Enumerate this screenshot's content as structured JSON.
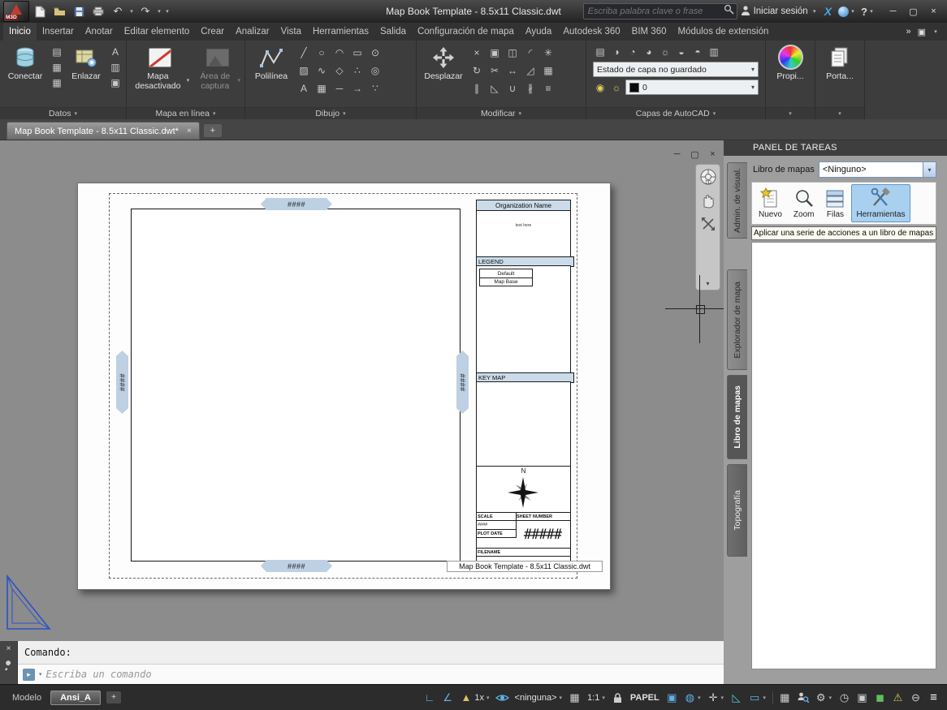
{
  "glyphs": {
    "chevron_down": "▾",
    "chevron_double": "»",
    "close": "×",
    "minimize": "─",
    "restore": "▢",
    "plus": "+",
    "undo": "↶",
    "redo": "↷",
    "question": "?",
    "x_brand": "X",
    "monitor": "▣",
    "line": "╱",
    "circle": "○",
    "arc": "◠",
    "rect": "▭",
    "ellipse": "⊙",
    "hatch": "▨",
    "spline": "∿",
    "polygon": "◇",
    "point": "∴",
    "donut": "◎",
    "text": "A",
    "table": "▦",
    "xline": "─",
    "ray": "→",
    "measure": "∵",
    "erase": "×",
    "copy": "▣",
    "mirror": "◫",
    "fillet": "◜",
    "explode": "✳",
    "rotate": "↻",
    "trim": "✂",
    "stretch": "↔",
    "scale": "◿",
    "array": "▦",
    "offset": "∥",
    "chamfer": "◺",
    "join": "∪",
    "break": "∦",
    "align": "≡",
    "layer_props": "▤",
    "layer_off": "◑",
    "layer_isolate": "◔",
    "layer_unisolate": "◕",
    "layer_freeze": "☼",
    "layer_lock": "◒",
    "layer_match": "◓",
    "layer_walk": "▥",
    "bulb": "◉",
    "sun": "☼",
    "ortho": "∟",
    "angle": "∠",
    "triangle": "▲",
    "grid": "▦",
    "globe": "◍",
    "crosshair": "✛",
    "tri_cyan": "◺",
    "rect_sel": "▭",
    "gear": "⚙",
    "clock": "◷",
    "cube": "◼",
    "warn": "⚠",
    "minus_circle": "⊖",
    "menu": "≡"
  },
  "titlebar": {
    "app_badge": "M3D",
    "title": "Map Book Template - 8.5x11 Classic.dwt",
    "search_placeholder": "Escriba palabra clave o frase",
    "signin": "Iniciar sesión"
  },
  "ribbon_tabs": [
    {
      "label": "Inicio"
    },
    {
      "label": "Insertar"
    },
    {
      "label": "Anotar"
    },
    {
      "label": "Editar elemento"
    },
    {
      "label": "Crear"
    },
    {
      "label": "Analizar"
    },
    {
      "label": "Vista"
    },
    {
      "label": "Herramientas"
    },
    {
      "label": "Salida"
    },
    {
      "label": "Configuración de mapa"
    },
    {
      "label": "Ayuda"
    },
    {
      "label": "Autodesk 360"
    },
    {
      "label": "BIM 360"
    },
    {
      "label": "Módulos de extensión"
    }
  ],
  "ribbon": {
    "datos": {
      "footer": "Datos",
      "connect": "Conectar",
      "link": "Enlazar"
    },
    "mapa": {
      "footer": "Mapa en línea",
      "map_off": "Mapa desactivado",
      "capture": "Área de captura"
    },
    "dibujo": {
      "footer": "Dibujo",
      "polyline": "Polilínea"
    },
    "modificar": {
      "footer": "Modificar",
      "move": "Desplazar"
    },
    "capas": {
      "footer": "Capas de AutoCAD",
      "layer_state": "Estado de capa no guardado",
      "layer_name": "0"
    },
    "propiedades": {
      "label": "Propi..."
    },
    "portaplanos": {
      "label": "Porta..."
    }
  },
  "doc_tab": {
    "label": "Map Book Template - 8.5x11 Classic.dwt*"
  },
  "template": {
    "org_name": "Organization Name",
    "org_text": "text here",
    "legend_title": "LEGEND",
    "legend_item_1": "Default",
    "legend_item_2": "Map Base",
    "keymap_title": "KEY MAP",
    "north_label": "N",
    "grip_label": "####",
    "scale_label": "SCALE",
    "scale_value": "####",
    "sheet_number_label": "SHEET NUMBER",
    "sheet_number_value": "#####",
    "plot_date_label": "PLOT DATE",
    "filename_label": "FILENAME",
    "caption": "Map Book Template - 8.5x11 Classic.dwt"
  },
  "task_panel": {
    "title": "PANEL DE TAREAS",
    "map_book_label": "Libro de mapas",
    "map_book_value": "<Ninguno>",
    "toolbar": [
      {
        "label": "Nuevo"
      },
      {
        "label": "Zoom"
      },
      {
        "label": "Filas"
      },
      {
        "label": "Herramientas"
      }
    ],
    "tooltip": "Aplicar una serie de acciones a un libro de mapas",
    "tabs": [
      {
        "label": "Admin. de visual."
      },
      {
        "label": "Explorador de mapa"
      },
      {
        "label": "Libro de mapas"
      },
      {
        "label": "Topografía"
      }
    ]
  },
  "command": {
    "prompt": "Comando:",
    "placeholder": "Escriba un comando"
  },
  "statusbar": {
    "model_tab": "Modelo",
    "layout_tab": "Ansi_A",
    "annotation_scale": "1x",
    "annotation_visibility": "<ninguna>",
    "viewport_scale": "1:1",
    "space_toggle": "PAPEL"
  },
  "colors": {
    "accent_blue": "#5fb2e8",
    "selection_blue": "#a9d1ef",
    "grip_blue": "#bdd0e4",
    "map_off_red": "#cf3a2e"
  }
}
